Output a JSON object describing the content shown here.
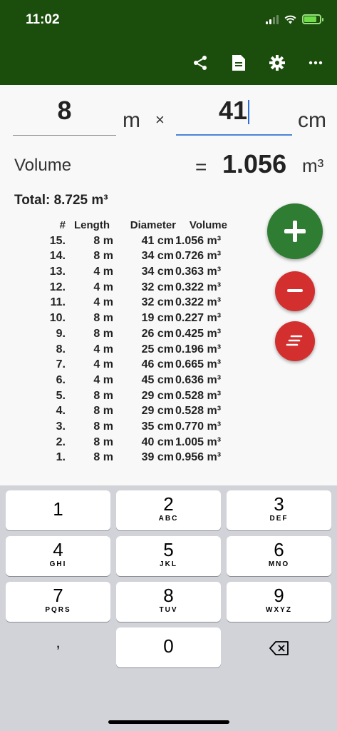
{
  "status_bar": {
    "time": "11:02"
  },
  "toolbar": {
    "icons": [
      "share-icon",
      "document-icon",
      "gear-icon",
      "more-icon"
    ]
  },
  "inputs": {
    "length_value": "8",
    "length_unit": "m",
    "times_symbol": "×",
    "diameter_value": "41",
    "diameter_unit": "cm"
  },
  "volume": {
    "label": "Volume",
    "equals": "=",
    "value": "1.056",
    "unit": "m³"
  },
  "total": "Total: 8.725 m³",
  "table": {
    "headers": {
      "num": "#",
      "length": "Length",
      "diameter": "Diameter",
      "volume": "Volume"
    },
    "rows": [
      {
        "num": "15.",
        "length": "8 m",
        "diameter": "41 cm",
        "volume": "1.056 m³"
      },
      {
        "num": "14.",
        "length": "8 m",
        "diameter": "34 cm",
        "volume": "0.726 m³"
      },
      {
        "num": "13.",
        "length": "4 m",
        "diameter": "34 cm",
        "volume": "0.363 m³"
      },
      {
        "num": "12.",
        "length": "4 m",
        "diameter": "32 cm",
        "volume": "0.322 m³"
      },
      {
        "num": "11.",
        "length": "4 m",
        "diameter": "32 cm",
        "volume": "0.322 m³"
      },
      {
        "num": "10.",
        "length": "8 m",
        "diameter": "19 cm",
        "volume": "0.227 m³"
      },
      {
        "num": "9.",
        "length": "8 m",
        "diameter": "26 cm",
        "volume": "0.425 m³"
      },
      {
        "num": "8.",
        "length": "4 m",
        "diameter": "25 cm",
        "volume": "0.196 m³"
      },
      {
        "num": "7.",
        "length": "4 m",
        "diameter": "46 cm",
        "volume": "0.665 m³"
      },
      {
        "num": "6.",
        "length": "4 m",
        "diameter": "45 cm",
        "volume": "0.636 m³"
      },
      {
        "num": "5.",
        "length": "8 m",
        "diameter": "29 cm",
        "volume": "0.528 m³"
      },
      {
        "num": "4.",
        "length": "8 m",
        "diameter": "29 cm",
        "volume": "0.528 m³"
      },
      {
        "num": "3.",
        "length": "8 m",
        "diameter": "35 cm",
        "volume": "0.770 m³"
      },
      {
        "num": "2.",
        "length": "8 m",
        "diameter": "40 cm",
        "volume": "1.005 m³"
      },
      {
        "num": "1.",
        "length": "8 m",
        "diameter": "39 cm",
        "volume": "0.956 m³"
      }
    ]
  },
  "fabs": {
    "add": "plus-icon",
    "remove": "minus-icon",
    "clear": "clear-list-icon"
  },
  "keyboard": {
    "keys": [
      {
        "num": "1",
        "letters": ""
      },
      {
        "num": "2",
        "letters": "ABC"
      },
      {
        "num": "3",
        "letters": "DEF"
      },
      {
        "num": "4",
        "letters": "GHI"
      },
      {
        "num": "5",
        "letters": "JKL"
      },
      {
        "num": "6",
        "letters": "MNO"
      },
      {
        "num": "7",
        "letters": "PQRS"
      },
      {
        "num": "8",
        "letters": "TUV"
      },
      {
        "num": "9",
        "letters": "WXYZ"
      },
      {
        "num": "0",
        "letters": ""
      }
    ],
    "comma": ",",
    "delete": "backspace-icon"
  },
  "colors": {
    "header": "#1b4d0c",
    "add_button": "#2e7d32",
    "remove_button": "#d32f2f",
    "active_underline": "#4a86d8"
  }
}
